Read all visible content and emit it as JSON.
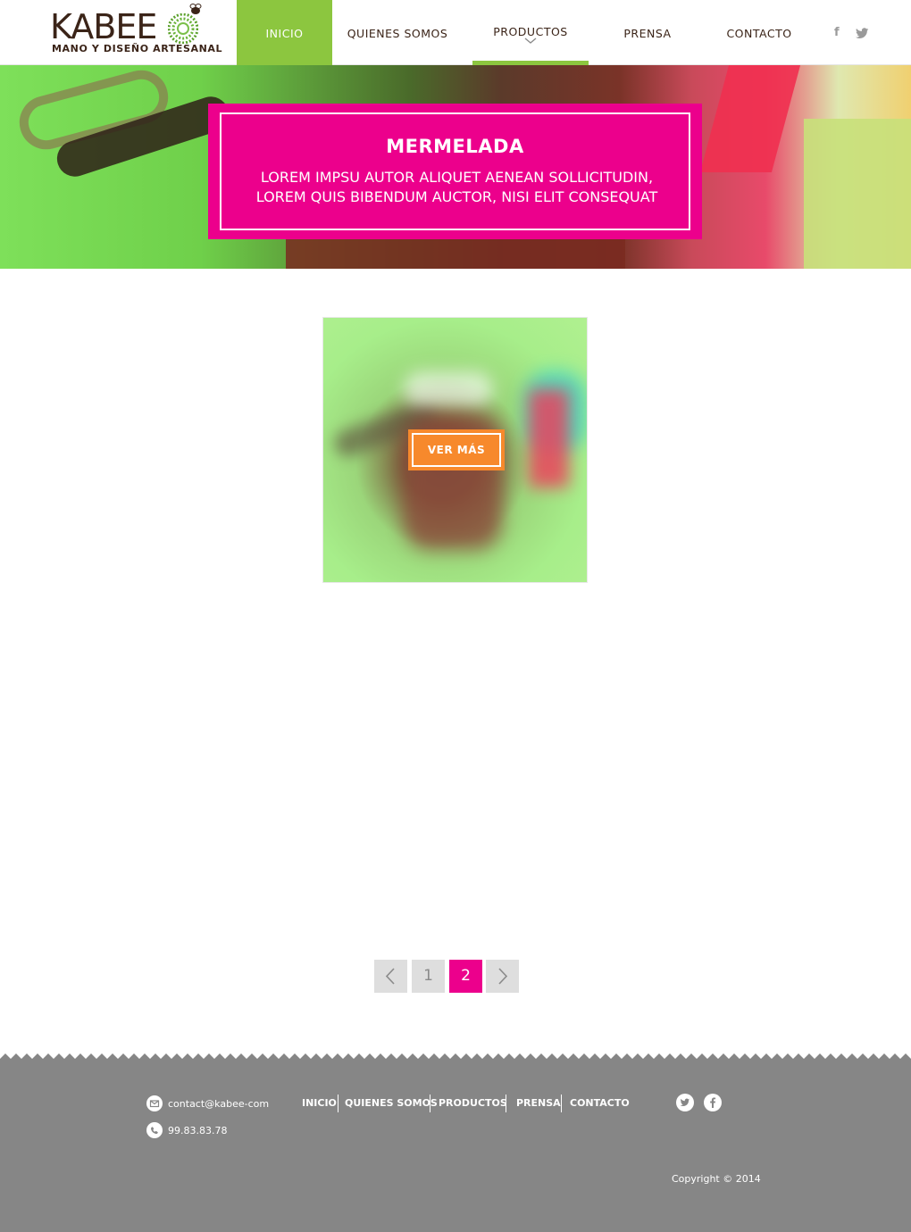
{
  "brand": {
    "name": "KABEE",
    "tagline": "MANO Y DISEÑO ARTESANAL"
  },
  "nav": {
    "items": [
      {
        "label": "INICIO",
        "active": true
      },
      {
        "label": "QUIENES SOMOS",
        "active": false
      },
      {
        "label": "PRODUCTOS",
        "active": false,
        "submenu_open": true
      },
      {
        "label": "PRENSA",
        "active": false
      },
      {
        "label": "CONTACTO",
        "active": false
      }
    ],
    "social": {
      "facebook": "f",
      "twitter_icon": "twitter-icon",
      "facebook_icon": "facebook-icon"
    }
  },
  "hero": {
    "title": "MERMELADA",
    "text": "LOREM IMPSU AUTOR ALIQUET AENEAN SOLLICITUDIN, LOREM QUIS BIBENDUM AUCTOR, NISI ELIT CONSEQUAT"
  },
  "product": {
    "button_label": "VER MÁS"
  },
  "pagination": {
    "prev_icon": "chevron-left-icon",
    "pages": [
      "1",
      "2"
    ],
    "current": "2",
    "next_icon": "chevron-right-icon"
  },
  "footer": {
    "email": "contact@kabee-com",
    "phone": "99.83.83.78",
    "nav": [
      "INICIO",
      "QUIENES SOMOS",
      "PRODUCTOS",
      "PRENSA",
      "CONTACTO"
    ],
    "copyright": "Copyright © 2014"
  },
  "colors": {
    "accent_green": "#8cc63f",
    "accent_pink": "#ec008c",
    "accent_orange": "#f7892c",
    "footer_gray": "#868686"
  }
}
